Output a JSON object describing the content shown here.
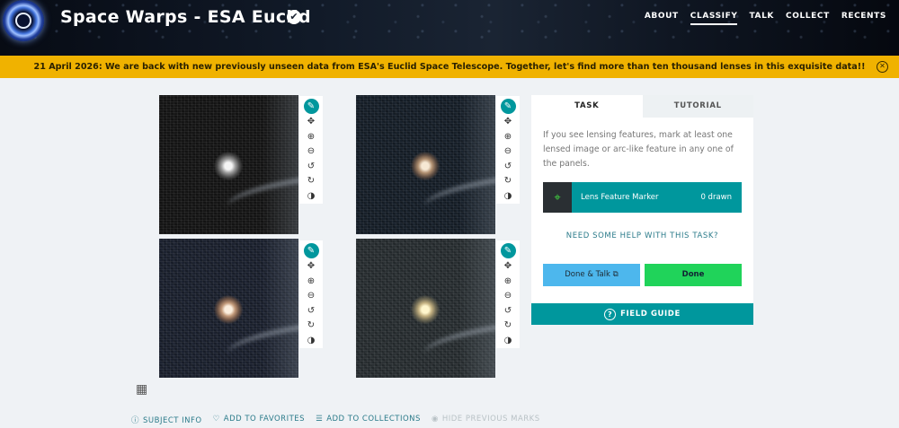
{
  "header": {
    "title": "Space Warps - ESA Euclid",
    "verified_icon": "✔",
    "nav": [
      "ABOUT",
      "CLASSIFY",
      "TALK",
      "COLLECT",
      "RECENTS"
    ],
    "active_nav": "CLASSIFY"
  },
  "banner": {
    "text": "21 April 2026: We are back with new previously unseen data from ESA's Euclid Space Telescope. Together, let's find more than ten thousand lenses in this exquisite data!!",
    "close_icon": "✕",
    "color": "#f0b200"
  },
  "subject_panels": {
    "tools": [
      {
        "name": "pen-icon",
        "glyph": "✎"
      },
      {
        "name": "move-icon",
        "glyph": "✥"
      },
      {
        "name": "zoom-in-icon",
        "glyph": "⊕"
      },
      {
        "name": "zoom-out-icon",
        "glyph": "⊖"
      },
      {
        "name": "rotate-left-icon",
        "glyph": "↺"
      },
      {
        "name": "rotate-right-icon",
        "glyph": "↻"
      },
      {
        "name": "invert-icon",
        "glyph": "◑"
      }
    ]
  },
  "gallery_icon": "▦",
  "bottom_links": {
    "subject_info": "SUBJECT INFO",
    "subject_info_icon": "ⓘ",
    "favorites": "ADD TO FAVORITES",
    "favorites_icon": "♡",
    "collections": "ADD TO COLLECTIONS",
    "collections_icon": "☰",
    "hide_marks": "HIDE PREVIOUS MARKS",
    "hide_marks_icon": "◉"
  },
  "task": {
    "tab_task": "TASK",
    "tab_tutorial": "TUTORIAL",
    "instructions": "If you see lensing features, mark at least one lensed image or arc-like feature in any one of the panels.",
    "tool_label": "Lens Feature Marker",
    "tool_count": "0 drawn",
    "tool_icon": "⌖",
    "help_link": "NEED SOME HELP WITH THIS TASK?",
    "done_talk": "Done & Talk",
    "done_talk_icon": "⧉",
    "done": "Done",
    "field_guide": "FIELD GUIDE",
    "field_guide_icon": "?",
    "accent_color": "#00979d",
    "done_color": "#20d35a",
    "talk_color": "#4db7ed"
  }
}
